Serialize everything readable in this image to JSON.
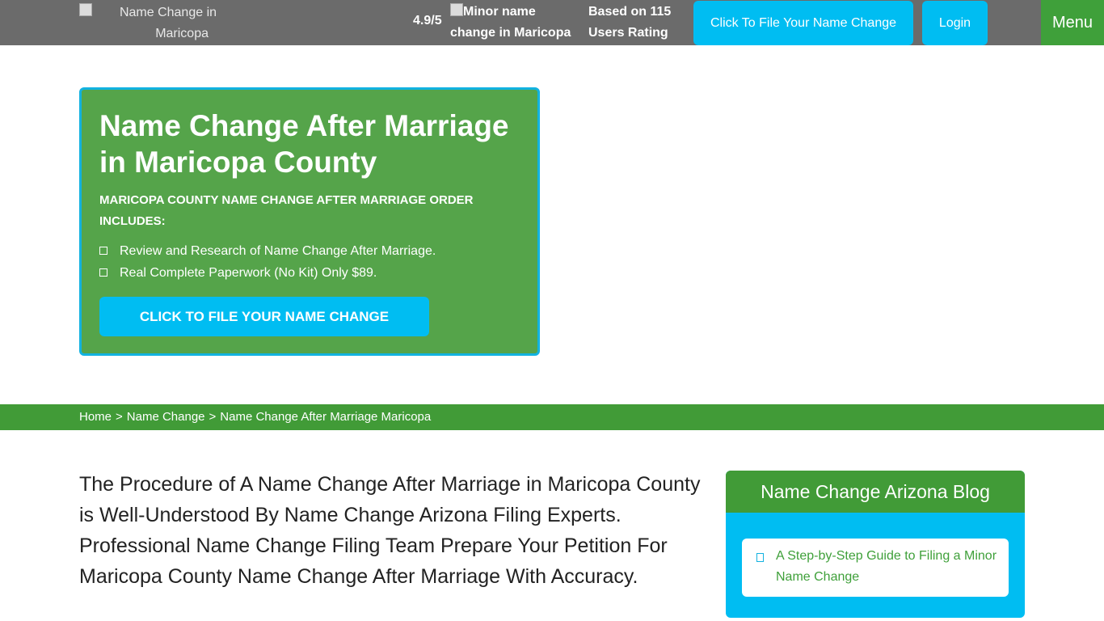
{
  "header": {
    "logo_alt_line1": "Name Change in",
    "logo_alt_line2": "Maricopa",
    "rating_score": "4.9/5",
    "rating_image_alt": "Minor name change in Maricopa",
    "rating_based_on": "Based on 115 Users Rating",
    "file_button_label": "Click To File Your Name Change",
    "login_label": "Login",
    "menu_label": "Menu"
  },
  "hero": {
    "title": "Name Change After Marriage in Maricopa County",
    "subhead": "MARICOPA COUNTY NAME CHANGE AFTER MARRIAGE ORDER INCLUDES:",
    "items": [
      "Review and Research of Name Change After Marriage.",
      "Real Complete Paperwork (No Kit) Only $89."
    ],
    "cta_label": "CLICK TO FILE YOUR NAME CHANGE"
  },
  "breadcrumb": {
    "items": [
      "Home",
      "Name Change",
      "Name Change After Marriage Maricopa"
    ],
    "separator": ">"
  },
  "main": {
    "paragraph": "The Procedure of A Name Change After Marriage in Maricopa County is Well-Understood By Name Change Arizona Filing Experts. Professional Name Change Filing Team Prepare Your Petition For Maricopa County Name Change After Marriage With Accuracy."
  },
  "sidebar": {
    "blog_title": "Name Change Arizona Blog",
    "posts": [
      "A Step-by-Step Guide to Filing a Minor Name Change"
    ]
  },
  "colors": {
    "topbar": "#6b6b6b",
    "accent_blue": "#00bdf2",
    "brand_green": "#419b37",
    "hero_green": "#55a44a"
  }
}
